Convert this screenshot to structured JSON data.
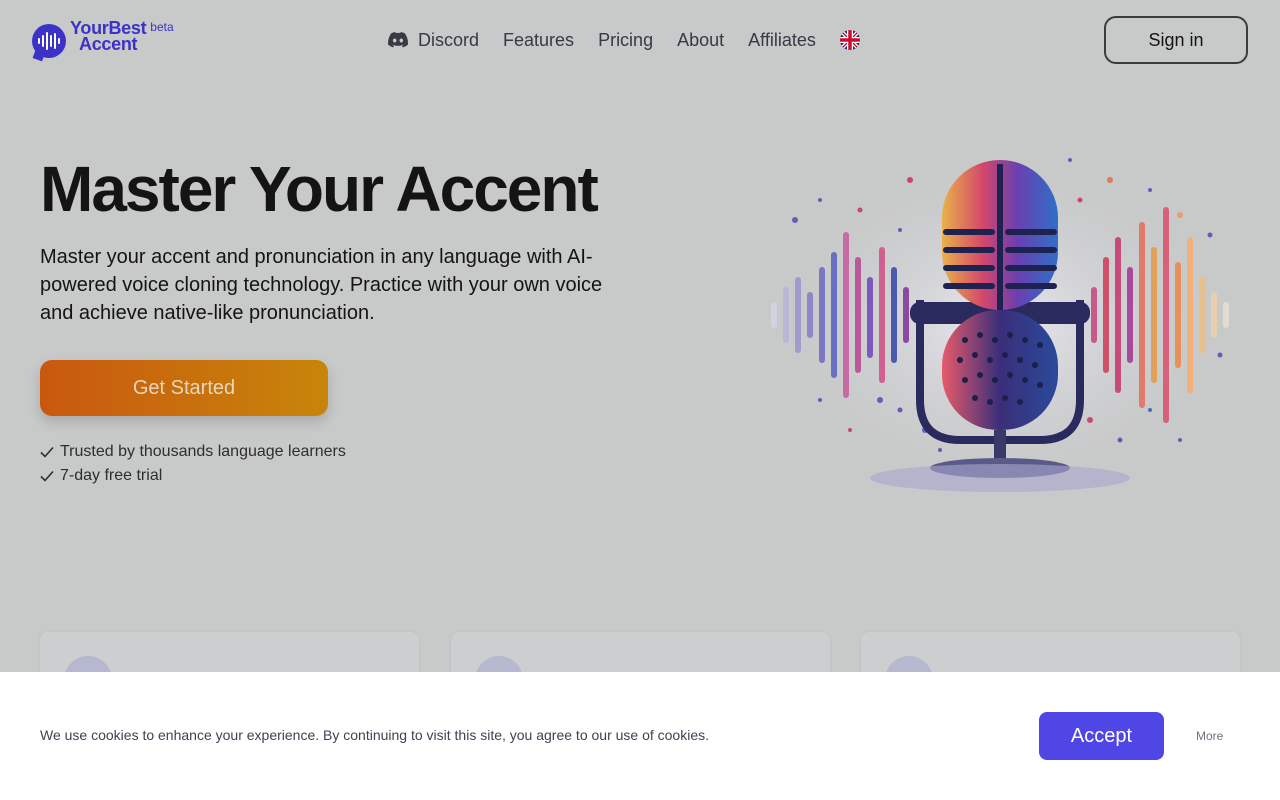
{
  "brand": {
    "line1": "YourBest",
    "line2": "Accent",
    "badge": "beta",
    "color": "#3d32c8"
  },
  "nav": {
    "items": [
      {
        "label": "Discord",
        "icon": "discord-icon"
      },
      {
        "label": "Features"
      },
      {
        "label": "Pricing"
      },
      {
        "label": "About"
      },
      {
        "label": "Affiliates"
      }
    ],
    "language_icon": "uk-flag-icon",
    "signin_label": "Sign in"
  },
  "hero": {
    "title": "Master Your Accent",
    "subtitle": "Master your accent and pronunciation in any language with AI-powered voice cloning technology. Practice with your own voice and achieve native-like pronunciation.",
    "cta_label": "Get Started",
    "checks": [
      "Trusted by thousands language learners",
      "7-day free trial"
    ],
    "image_icon": "microphone-illustration"
  },
  "cookie": {
    "text": "We use cookies to enhance your experience. By continuing to visit this site, you agree to our use of cookies.",
    "accept_label": "Accept",
    "more_label": "More",
    "accent": "#4f46e5"
  }
}
